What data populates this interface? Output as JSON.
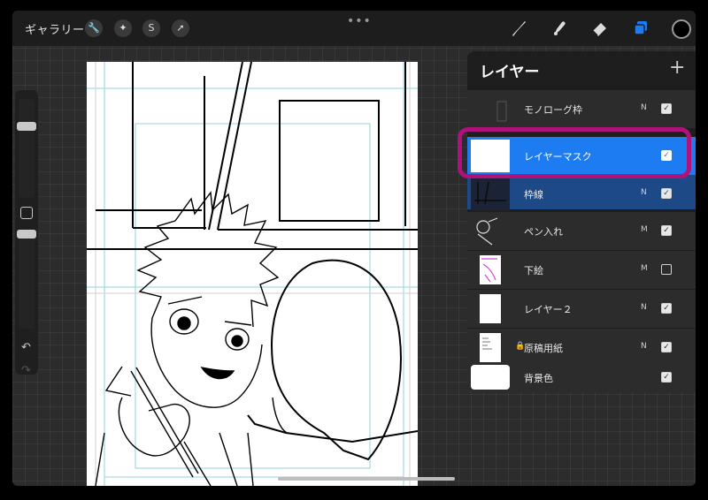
{
  "toolbar": {
    "gallery_label": "ギャラリー",
    "more_label": "•••",
    "left_tools": [
      {
        "icon": "wrench-icon",
        "glyph": "🔧"
      },
      {
        "icon": "magic-wand-icon",
        "glyph": "✦"
      },
      {
        "icon": "selection-icon",
        "glyph": "S"
      },
      {
        "icon": "transform-arrow-icon",
        "glyph": "➚"
      }
    ],
    "right_tools": [
      "brush-icon",
      "smudge-icon",
      "eraser-icon",
      "layers-icon",
      "color-icon"
    ],
    "active_tool_color": "#1e7cf2",
    "current_color": "#000000"
  },
  "sidebar": {
    "brush_size_level": 0.25,
    "opacity_level": 0.0,
    "undo_glyph": "↶",
    "redo_glyph": "↷"
  },
  "layers_panel": {
    "title": "レイヤー",
    "add_glyph": "+",
    "highlight_color": "#b0127c",
    "layers": [
      {
        "name": "モノローグ枠",
        "blend": "N",
        "visible": true,
        "locked": false,
        "state": "normal"
      },
      {
        "name": "レイヤーマスク",
        "blend": "",
        "visible": true,
        "locked": false,
        "state": "selected"
      },
      {
        "name": "枠線",
        "blend": "N",
        "visible": true,
        "locked": false,
        "state": "mask-parent"
      },
      {
        "name": "ペン入れ",
        "blend": "M",
        "visible": true,
        "locked": false,
        "state": "normal"
      },
      {
        "name": "下絵",
        "blend": "M",
        "visible": false,
        "locked": false,
        "state": "normal"
      },
      {
        "name": "レイヤー２",
        "blend": "N",
        "visible": true,
        "locked": false,
        "state": "normal"
      },
      {
        "name": "原稿用紙",
        "blend": "N",
        "visible": true,
        "locked": true,
        "state": "normal"
      },
      {
        "name": "背景色",
        "blend": "",
        "visible": true,
        "locked": false,
        "state": "normal"
      }
    ]
  }
}
